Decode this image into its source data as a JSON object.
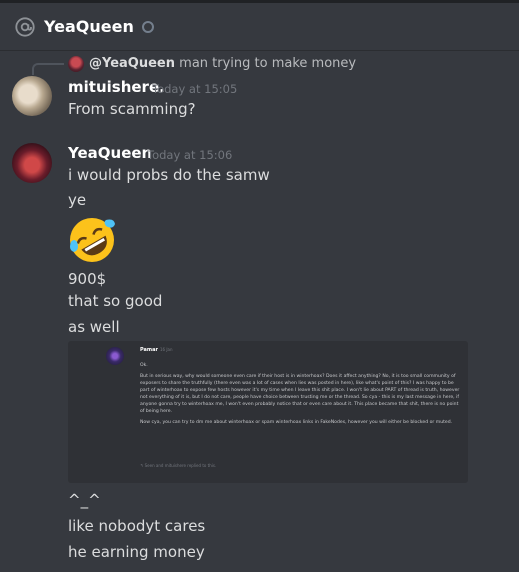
{
  "header": {
    "title": "YeaQueen"
  },
  "reply": {
    "user": "@YeaQueen",
    "text": "man trying to make money"
  },
  "messages": [
    {
      "user": "mituishere.",
      "time": "Today at 15:05",
      "lines": [
        "From scamming?"
      ]
    },
    {
      "user": "YeaQueen",
      "time": "Today at 15:06",
      "lines": [
        "i would probs do the samw",
        "ye",
        "900$",
        "that so good",
        "as well",
        "^_^",
        "like nobodyt cares",
        "he earning money"
      ]
    }
  ],
  "icons": {
    "header": "at-sign-icon",
    "status": "offline-status-icon",
    "emoji": "rofl-emoji-icon"
  },
  "embed": {
    "user": "Pamar",
    "time": "16 Jan",
    "paragraphs": [
      "Ok.",
      "But in serious way, why would someone even care if their host is in winterhoax? Does it affect anything? No, it is too small community of exposers to share the truthfully (there even was a lot of cases when lies was posted in here), like what's point of this? I was happy to be part of winterhoax to expose few hosts however it's my time when I leave this shit place. I won't lie about PART of thread is truth, however not everything of it is, but I do not care, people have choice between trusting me or the thread. So cya - this is my last message in here, if anyone gonna try to winterhoax me, I won't even probably notice that or even care about it. This place became that shit, there is no point of being here.",
      "Now cya, you can try to dm me about winterhoax or spam winterhoax links in FakeNodes, however you will either be blocked or muted."
    ],
    "footer": "Seen and mituishere replied to this."
  },
  "colors": {
    "background": "#36393f",
    "text": "#dcddde",
    "username": "#ffffff",
    "timestamp": "#72767d",
    "embed_bg": "#2f3136"
  }
}
